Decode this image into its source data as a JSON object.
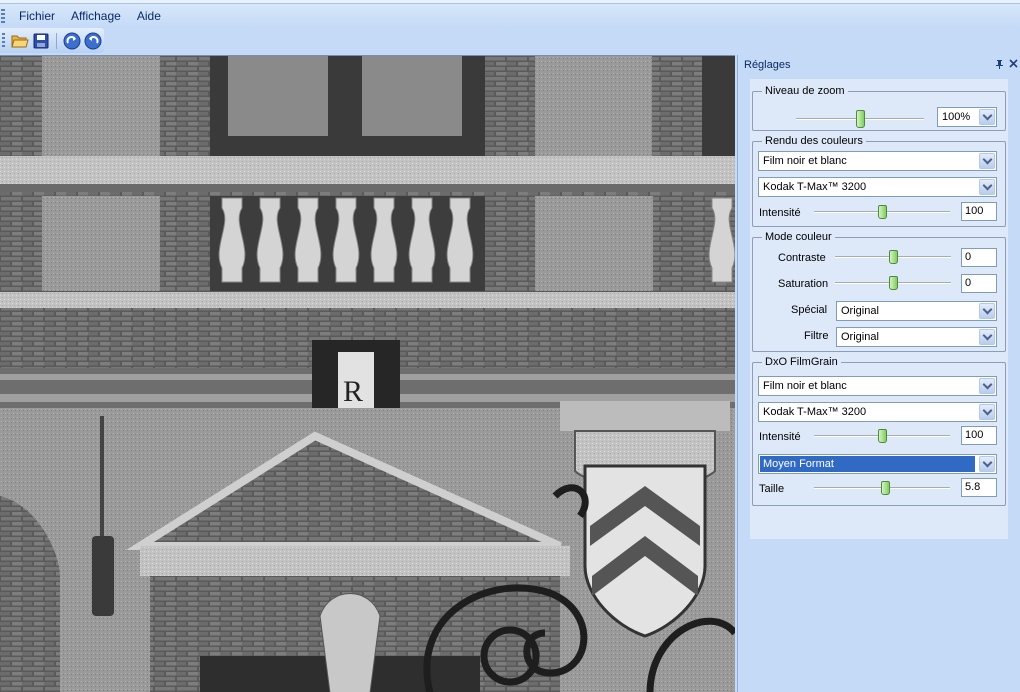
{
  "menu": {
    "items": [
      "Fichier",
      "Affichage",
      "Aide"
    ]
  },
  "toolbar": {
    "buttons": [
      {
        "icon": "open-folder-icon"
      },
      {
        "icon": "save-icon"
      },
      {
        "icon": "redo-icon"
      },
      {
        "icon": "undo-icon"
      }
    ]
  },
  "panel": {
    "title": "Réglages",
    "pin_icon": "pin-icon",
    "close_icon": "close-icon",
    "zoom": {
      "legend": "Niveau de zoom",
      "slider_level": 0.5,
      "value": "100%"
    },
    "rendu": {
      "legend": "Rendu des couleurs",
      "type": "Film noir et blanc",
      "film": "Kodak T-Max™ 3200",
      "intensite_label": "Intensité",
      "intensite_level": 0.5,
      "intensite_value": "100"
    },
    "mode": {
      "legend": "Mode couleur",
      "contraste_label": "Contraste",
      "contraste_level": 0.5,
      "contraste_value": "0",
      "saturation_label": "Saturation",
      "saturation_level": 0.5,
      "saturation_value": "0",
      "special_label": "Spécial",
      "special_value": "Original",
      "filtre_label": "Filtre",
      "filtre_value": "Original"
    },
    "grain": {
      "legend": "DxO FilmGrain",
      "type": "Film noir et blanc",
      "film": "Kodak T-Max™ 3200",
      "intensite_label": "Intensité",
      "intensite_level": 0.5,
      "intensite_value": "100",
      "format": "Moyen Format",
      "taille_label": "Taille",
      "taille_level": 0.53,
      "taille_value": "5.8"
    }
  }
}
